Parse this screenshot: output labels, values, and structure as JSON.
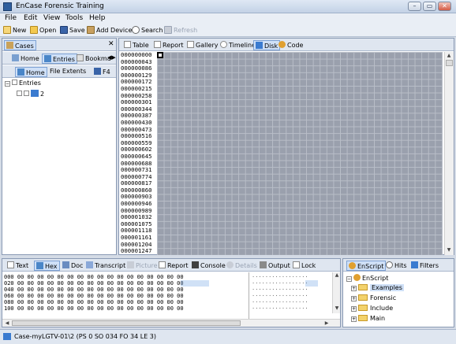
{
  "window": {
    "title": "EnCase Forensic Training"
  },
  "menu": [
    "File",
    "Edit",
    "View",
    "Tools",
    "Help"
  ],
  "toolbar": {
    "new": "New",
    "open": "Open",
    "save": "Save",
    "add_device": "Add Device",
    "search": "Search",
    "refresh": "Refresh"
  },
  "left_pane": {
    "cases_tab": "Cases",
    "tabs": [
      "Home",
      "Entries",
      "Bookma"
    ],
    "subtabs": [
      "Home",
      "File Extents",
      "F4"
    ],
    "tree": {
      "root": "Entries",
      "child": "2"
    }
  },
  "right_pane": {
    "tabs": [
      "Table",
      "Report",
      "Gallery",
      "Timeline",
      "Disk",
      "Code"
    ],
    "active_tab": "Disk",
    "offsets": [
      "000000000",
      "000000043",
      "000000086",
      "000000129",
      "000000172",
      "000000215",
      "000000258",
      "000000301",
      "000000344",
      "000000387",
      "000000430",
      "000000473",
      "000000516",
      "000000559",
      "000000602",
      "000000645",
      "000000688",
      "000000731",
      "000000774",
      "000000817",
      "000000860",
      "000000903",
      "000000946",
      "000000989",
      "000001032",
      "000001075",
      "000001118",
      "000001161",
      "000001204",
      "000001247"
    ]
  },
  "bottom_pane": {
    "tabs": [
      "Text",
      "Hex",
      "Doc",
      "Transcript",
      "Picture",
      "Report",
      "Console",
      "Details",
      "Output",
      "Lock"
    ],
    "active_tab": "Hex",
    "hex_rows": [
      "000 00 00 00 00 00 00 00 00 00 00 00 00 00 00 00 00 00",
      "020 00 00 00 00 00 00 00 00 00 00 00 00 00 00 00 00 00",
      "040 00 00 00 00 00 00 00 00 00 00 00 00 00 00 00 00 00",
      "060 00 00 00 00 00 00 00 00 00 00 00 00 00 00 00 00 00",
      "080 00 00 00 00 00 00 00 00 00 00 00 00 00 00 00 00 00",
      "100 00 00 00 00 00 00 00 00 00 00 00 00 00 00 00 00 00"
    ],
    "text_rows": [
      "·················",
      "·················",
      "·················",
      "·················",
      "·················",
      "·················"
    ]
  },
  "script_pane": {
    "tabs": [
      "EnScript",
      "Hits",
      "Filters"
    ],
    "tree": {
      "root": "EnScript",
      "items": [
        "Examples",
        "Forensic",
        "Include",
        "Main"
      ],
      "selected": "Examples"
    }
  },
  "status": {
    "text": "Case-myLGTV-01\\2 (PS 0 SO 034 FO 34 LE 3)"
  }
}
